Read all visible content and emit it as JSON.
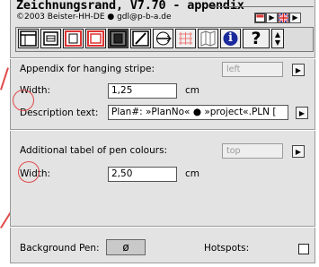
{
  "header": {
    "title": "Zeichnungsrand, V7.70 - appendix",
    "copyright": "©2003 Beister-HH-DE ● gdl@p-b-a.de"
  },
  "toolbar": {
    "tools": [
      {
        "icon": "drawing-frame-icon"
      },
      {
        "icon": "printer-stamp-icon"
      },
      {
        "icon": "red-frame-icon"
      },
      {
        "icon": "red-double-frame-icon"
      },
      {
        "icon": "dark-frame-icon"
      },
      {
        "icon": "pen-edit-icon"
      },
      {
        "icon": "scale-arrow-icon"
      },
      {
        "icon": "red-grid-icon"
      },
      {
        "icon": "folded-sheets-icon"
      },
      {
        "icon": "info-icon"
      },
      {
        "icon": "help-icon"
      },
      {
        "icon": "scroll-arrows-icon"
      }
    ],
    "info_glyph": "i",
    "help_glyph": "?"
  },
  "appendix": {
    "label": "Appendix for hanging stripe:",
    "position_value": "left",
    "width_label": "Width:",
    "width_value": "1,25",
    "width_unit": "cm",
    "description_label": "Description text:",
    "description_value": "Plan#: »PlanNo« ● »project«.PLN ["
  },
  "pen_colours": {
    "label": "Additional tabel of pen colours:",
    "position_value": "top",
    "width_label": "Width:",
    "width_value": "2,50",
    "width_unit": "cm"
  },
  "footer": {
    "background_pen_label": "Background Pen:",
    "background_pen_value": "ø",
    "hotspots_label": "Hotspots:"
  },
  "colors": {
    "panel": "#e3e3e3",
    "annotation_red": "#e24a4a",
    "accent_blue": "#1a2a9c"
  }
}
